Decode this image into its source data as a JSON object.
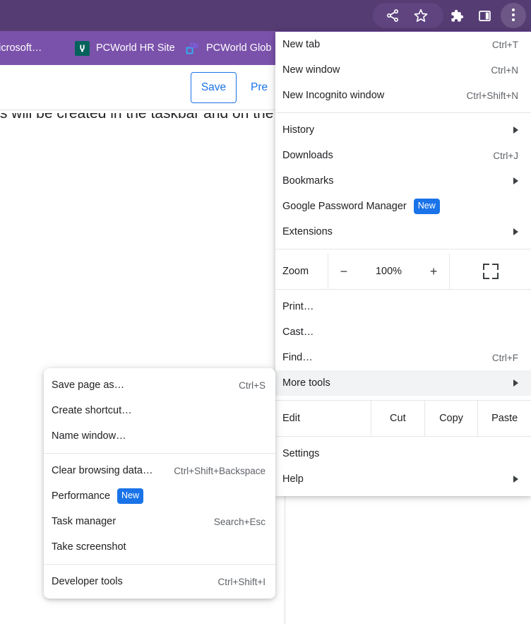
{
  "browser": {
    "toolbar_icons": [
      {
        "name": "share-icon",
        "glyph": "share"
      },
      {
        "name": "bookmark-star-icon",
        "glyph": "star"
      },
      {
        "name": "extensions-puzzle-icon",
        "glyph": "puzzle"
      },
      {
        "name": "side-panel-icon",
        "glyph": "panel"
      },
      {
        "name": "chrome-menu-icon",
        "glyph": "three-dots"
      }
    ],
    "bookmarks": [
      {
        "label": "d Microsoft…",
        "icon": "none"
      },
      {
        "label": "PCWorld HR Site",
        "icon": "hr-site-icon"
      },
      {
        "label": "PCWorld Glob",
        "icon": "global-squares-icon"
      }
    ]
  },
  "page": {
    "save_label": "Save",
    "preview_label": "Pre",
    "body_text": "ts will be created in the taskbar and on the",
    "accent_color": "#1a73e8"
  },
  "main_menu": {
    "groups": [
      {
        "items": [
          {
            "label": "New tab",
            "shortcut": "Ctrl+T",
            "arrow": false
          },
          {
            "label": "New window",
            "shortcut": "Ctrl+N",
            "arrow": false
          },
          {
            "label": "New Incognito window",
            "shortcut": "Ctrl+Shift+N",
            "arrow": false
          }
        ]
      },
      {
        "items": [
          {
            "label": "History",
            "shortcut": "",
            "arrow": true
          },
          {
            "label": "Downloads",
            "shortcut": "Ctrl+J",
            "arrow": false
          },
          {
            "label": "Bookmarks",
            "shortcut": "",
            "arrow": true
          },
          {
            "label": "Google Password Manager",
            "shortcut": "",
            "arrow": false,
            "badge": "New"
          },
          {
            "label": "Extensions",
            "shortcut": "",
            "arrow": true
          }
        ]
      }
    ],
    "zoom_row": {
      "label": "Zoom",
      "minus": "−",
      "value": "100%",
      "plus": "+",
      "fullscreen_icon": "fullscreen-icon"
    },
    "group3": [
      {
        "label": "Print…",
        "shortcut": "",
        "arrow": false
      },
      {
        "label": "Cast…",
        "shortcut": "",
        "arrow": false
      },
      {
        "label": "Find…",
        "shortcut": "Ctrl+F",
        "arrow": false
      },
      {
        "label": "More tools",
        "shortcut": "",
        "arrow": true,
        "highlighted": true
      }
    ],
    "edit_row": {
      "label": "Edit",
      "actions": [
        "Cut",
        "Copy",
        "Paste"
      ]
    },
    "group4": [
      {
        "label": "Settings",
        "shortcut": "",
        "arrow": false
      },
      {
        "label": "Help",
        "shortcut": "",
        "arrow": true
      }
    ]
  },
  "sub_menu": {
    "groups": [
      [
        {
          "label": "Save page as…",
          "shortcut": "Ctrl+S"
        },
        {
          "label": "Create shortcut…",
          "shortcut": ""
        },
        {
          "label": "Name window…",
          "shortcut": ""
        }
      ],
      [
        {
          "label": "Clear browsing data…",
          "shortcut": "Ctrl+Shift+Backspace"
        },
        {
          "label": "Performance",
          "shortcut": "",
          "badge": "New"
        },
        {
          "label": "Task manager",
          "shortcut": "Search+Esc"
        },
        {
          "label": "Take screenshot",
          "shortcut": ""
        }
      ],
      [
        {
          "label": "Developer tools",
          "shortcut": "Ctrl+Shift+I"
        }
      ]
    ]
  }
}
